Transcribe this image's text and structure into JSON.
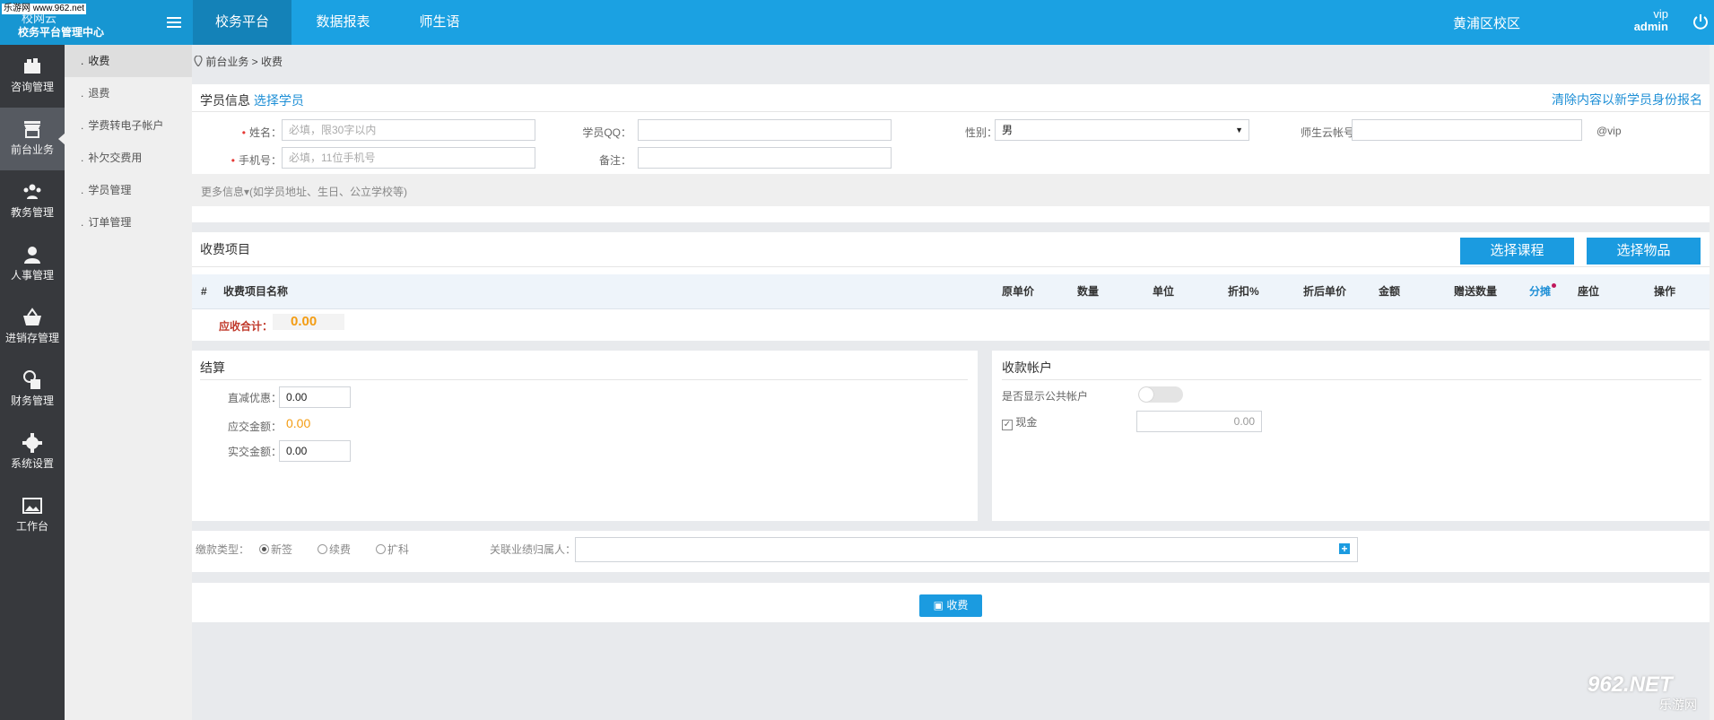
{
  "watermark": "乐游网 www.962.net",
  "brand": {
    "title": "校网云",
    "subtitle": "校务平台管理中心"
  },
  "top_tabs": [
    "校务平台",
    "数据报表",
    "师生语"
  ],
  "campus": "黄浦区校区",
  "user": {
    "level": "vip",
    "name": "admin"
  },
  "icon_nav": [
    {
      "label": "咨询管理",
      "icon": "folder-stack-icon"
    },
    {
      "label": "前台业务",
      "icon": "storefront-icon"
    },
    {
      "label": "教务管理",
      "icon": "users-group-icon"
    },
    {
      "label": "人事管理",
      "icon": "person-icon"
    },
    {
      "label": "进销存管理",
      "icon": "basket-icon"
    },
    {
      "label": "财务管理",
      "icon": "finance-calendar-icon"
    },
    {
      "label": "系统设置",
      "icon": "gear-icon"
    },
    {
      "label": "工作台",
      "icon": "image-icon"
    }
  ],
  "sub_nav": [
    "收费",
    "退费",
    "学费转电子帐户",
    "补欠交费用",
    "学员管理",
    "订单管理"
  ],
  "breadcrumb": "前台业务 > 收费",
  "student": {
    "title": "学员信息",
    "select_link": "选择学员",
    "clear_link": "清除内容以新学员身份报名",
    "name_label": "姓名：",
    "name_placeholder": "必填，限30字以内",
    "phone_label": "手机号：",
    "phone_placeholder": "必填，11位手机号",
    "qq_label": "学员QQ：",
    "remark_label": "备注：",
    "gender_label": "性别：",
    "gender_value": "男",
    "cloud_label": "师生云帐号：",
    "cloud_suffix": "@vip",
    "more_info": "更多信息▾(如学员地址、生日、公立学校等)"
  },
  "fee_items": {
    "title": "收费项目",
    "btn_course": "选择课程",
    "btn_goods": "选择物品",
    "columns": [
      "#",
      "收费项目名称",
      "原单价",
      "数量",
      "单位",
      "折扣%",
      "折后单价",
      "金额",
      "赠送数量",
      "分摊",
      "座位",
      "操作"
    ],
    "total_label": "应收合计：",
    "total_value": "0.00"
  },
  "settlement": {
    "title": "结算",
    "discount_label": "直减优惠：",
    "discount_value": "0.00",
    "payable_label": "应交金额：",
    "payable_value": "0.00",
    "paid_label": "实交金额：",
    "paid_value": "0.00"
  },
  "account": {
    "title": "收款帐户",
    "public_label": "是否显示公共帐户",
    "cash_label": "现金",
    "cash_value": "0.00"
  },
  "payment_type": {
    "label": "缴款类型：",
    "options": [
      "新签",
      "续费",
      "扩科"
    ],
    "selected": "新签",
    "related_label": "关联业绩归属人："
  },
  "submit_label": "收费",
  "corner_logo": {
    "top": "962.NET",
    "bottom": "乐游网"
  },
  "colors": {
    "primary": "#1ba1e2",
    "accent_orange": "#f39c12",
    "danger": "#c0392b",
    "sidebar": "#37393d"
  }
}
